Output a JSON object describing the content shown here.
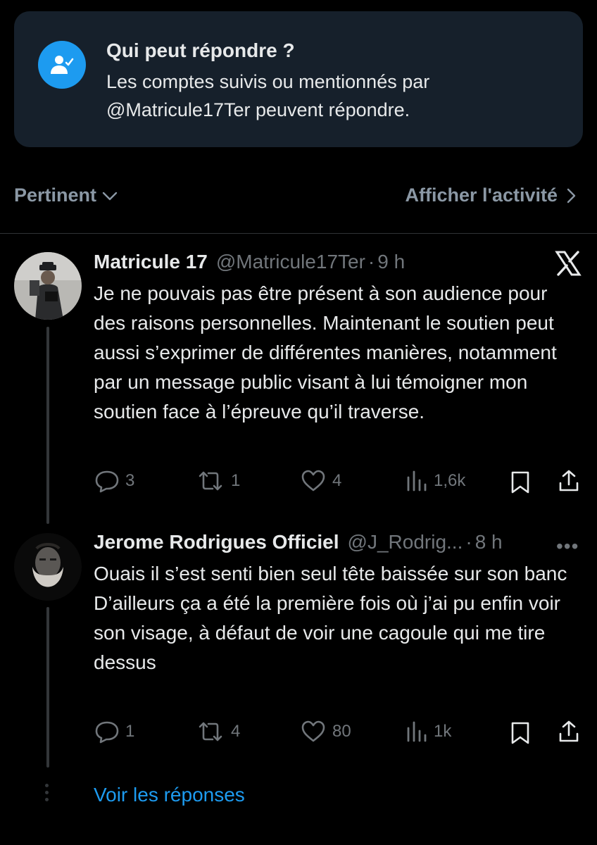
{
  "reply_settings": {
    "title": "Qui peut répondre ?",
    "description": "Les comptes suivis ou mentionnés par @Matricule17Ter peuvent répondre.",
    "icon": "user-check-icon",
    "accent_color": "#1d9bf0"
  },
  "filters": {
    "sort_label": "Pertinent",
    "activity_label": "Afficher l'activité"
  },
  "tweets": [
    {
      "name": "Matricule 17",
      "handle": "@Matricule17Ter",
      "separator": "·",
      "time": "9 h",
      "text": "Je ne pouvais pas être présent à son audience pour des raisons personnelles. Maintenant le soutien peut aussi s’exprimer de différentes manières, notamment par un message public visant à lui témoigner mon soutien face à l’épreuve qu’il traverse.",
      "replies": "3",
      "reposts": "1",
      "likes": "4",
      "views": "1,6k"
    },
    {
      "name": "Jerome Rodrigues Officiel",
      "handle": "@J_Rodrig...",
      "separator": "·",
      "time": "8 h",
      "more": "•••",
      "text": "Ouais il s’est senti bien seul tête baissée sur son banc\nD’ailleurs ça a été la première fois où j’ai pu enfin voir son visage, à défaut de voir une cagoule qui me tire dessus",
      "replies": "1",
      "reposts": "4",
      "likes": "80",
      "views": "1k"
    }
  ],
  "see_replies": "Voir les réponses"
}
